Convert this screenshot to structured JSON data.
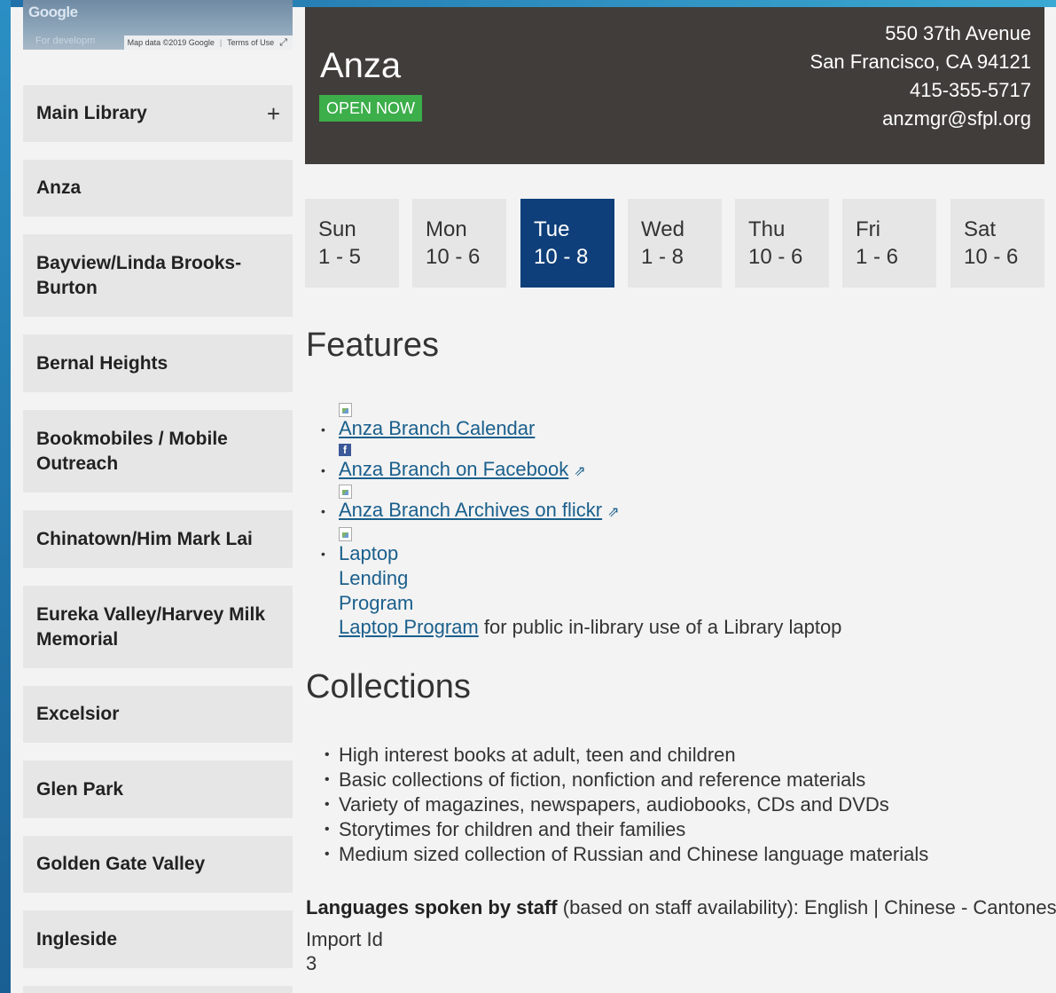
{
  "map": {
    "logo_text": "Google",
    "dev_text": "For developm",
    "map_data": "Map data ©2019 Google",
    "terms": "Terms of Use"
  },
  "sidebar": {
    "items": [
      {
        "label": "Main Library",
        "expandable": true
      },
      {
        "label": "Anza"
      },
      {
        "label": "Bayview/Linda Brooks-Burton"
      },
      {
        "label": "Bernal Heights"
      },
      {
        "label": "Bookmobiles / Mobile Outreach"
      },
      {
        "label": "Chinatown/Him Mark Lai"
      },
      {
        "label": "Eureka Valley/Harvey Milk Memorial"
      },
      {
        "label": "Excelsior"
      },
      {
        "label": "Glen Park"
      },
      {
        "label": "Golden Gate Valley"
      },
      {
        "label": "Ingleside"
      }
    ],
    "expand_symbol": "+"
  },
  "header": {
    "branch_name": "Anza",
    "open_status": "OPEN NOW",
    "address_line1": "550 37th Avenue",
    "address_line2": "San Francisco, CA 94121",
    "phone": "415-355-5717",
    "email": "anzmgr@sfpl.org",
    "status_color": "#3cae4a",
    "header_bg": "#403d3a"
  },
  "hours": {
    "days": [
      {
        "day": "Sun",
        "hours": "1 - 5"
      },
      {
        "day": "Mon",
        "hours": "10 - 6"
      },
      {
        "day": "Tue",
        "hours": "10 - 8",
        "active": true
      },
      {
        "day": "Wed",
        "hours": "1 - 8"
      },
      {
        "day": "Thu",
        "hours": "10 - 6"
      },
      {
        "day": "Fri",
        "hours": "1 - 6"
      },
      {
        "day": "Sat",
        "hours": "10 - 6"
      }
    ],
    "active_color": "#0f3f7a"
  },
  "features": {
    "title": "Features",
    "calendar_link": "Anza Branch Calendar",
    "facebook_link": "Anza Branch on Facebook",
    "flickr_link": "Anza Branch Archives on flickr",
    "laptop_line1": "Laptop",
    "laptop_line2": "Lending",
    "laptop_line3": "Program",
    "laptop_link": "Laptop Program",
    "laptop_desc": " for public in-library use of a Library laptop",
    "fb_letter": "f"
  },
  "collections": {
    "title": "Collections",
    "items": [
      "High interest books at adult, teen and children",
      "Basic collections of fiction, nonfiction and reference materials",
      "Variety of magazines, newspapers, audiobooks, CDs and DVDs",
      "Storytimes for children and their families",
      "Medium sized collection of Russian and Chinese language materials"
    ]
  },
  "languages": {
    "label": "Languages spoken by staff",
    "qualifier": " (based on staff availability): ",
    "value": "English | Chinese - Cantonese"
  },
  "import": {
    "label": "Import Id",
    "value": "3"
  },
  "external_link_symbol": "⇗"
}
